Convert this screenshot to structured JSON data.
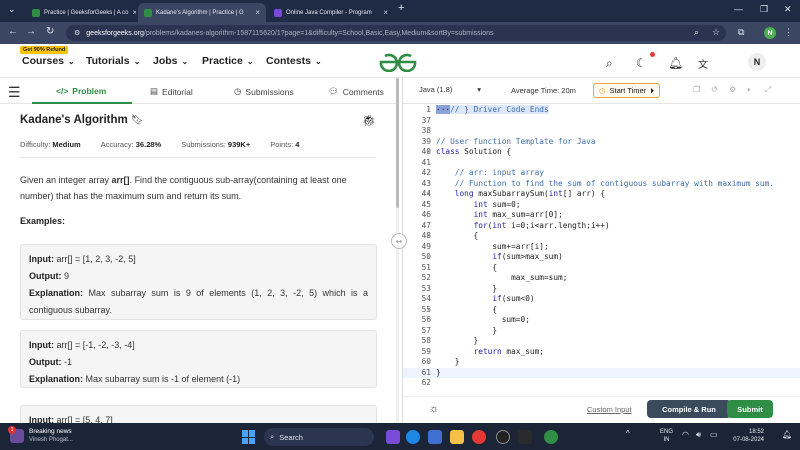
{
  "browser": {
    "tabs": [
      {
        "title": "Practice | GeeksforGeeks | A co",
        "color": "#2f8d46",
        "active": false
      },
      {
        "title": "Kadane's Algorithm | Practice | G",
        "color": "#2f8d46",
        "active": true
      },
      {
        "title": "Online Java Compiler - Program",
        "color": "#7a4bd6",
        "active": false
      }
    ],
    "new_tab": "+",
    "url_host": "geeksforgeeks.org",
    "url_path": "/problems/kadanes-algorithm-1587115620/1?page=1&difficulty=School,Basic,Easy,Medium&sortBy=submissions",
    "profile_initial": "N"
  },
  "site": {
    "refund_badge": "Get 90% Refund",
    "menus": [
      "Courses",
      "Tutorials",
      "Jobs",
      "Practice",
      "Contests"
    ],
    "avatar": "N",
    "brand_color": "#2f8d46"
  },
  "problem": {
    "tabs": [
      "Problem",
      "Editorial",
      "Submissions",
      "Comments"
    ],
    "title": "Kadane's Algorithm",
    "difficulty_label": "Difficulty:",
    "difficulty": "Medium",
    "accuracy_label": "Accuracy:",
    "accuracy": "36.28%",
    "submissions_label": "Submissions:",
    "submissions": "939K+",
    "points_label": "Points:",
    "points": "4",
    "description_pre": "Given an integer array ",
    "description_arr": "arr[]",
    "description_post": ". Find the contiguous sub-array(containing at least one number) that has the maximum sum and return its sum.",
    "examples_heading": "Examples:",
    "examples": [
      {
        "input": "arr[] = [1, 2, 3, -2, 5]",
        "output": "9",
        "explanation": "Max subarray sum is 9 of elements (1, 2, 3, -2, 5) which is a contiguous subarray."
      },
      {
        "input": "arr[] = [-1, -2, -3, -4]",
        "output": "-1",
        "explanation": "Max subarray sum is -1 of element (-1)"
      },
      {
        "input": "arr[] = [5, 4, 7]",
        "output": "",
        "explanation": ""
      }
    ],
    "input_label": "Input:",
    "output_label": "Output:",
    "explanation_label": "Explanation:"
  },
  "editor": {
    "language": "Java (1.8)",
    "avg_time": "Average Time: 20m",
    "timer_label": "Start Timer",
    "lines": [
      {
        "n": "1",
        "text": "// } Driver Code Ends",
        "fold": true
      },
      {
        "n": "37",
        "text": ""
      },
      {
        "n": "38",
        "text": ""
      },
      {
        "n": "39",
        "text": "// User function Template for Java"
      },
      {
        "n": "40",
        "text": "class Solution {",
        "fold": true
      },
      {
        "n": "41",
        "text": ""
      },
      {
        "n": "42",
        "text": "    // arr: input array"
      },
      {
        "n": "43",
        "text": "    // Function to find the sum of contiguous subarray with maximum sum."
      },
      {
        "n": "44",
        "text": "    long maxSubarraySum(int[] arr) {",
        "fold": true
      },
      {
        "n": "45",
        "text": "        int sum=0;"
      },
      {
        "n": "46",
        "text": "        int max_sum=arr[0];"
      },
      {
        "n": "47",
        "text": "        for(int i=0;i<arr.length;i++)"
      },
      {
        "n": "48",
        "text": "        {",
        "fold": true
      },
      {
        "n": "49",
        "text": "            sum+=arr[i];"
      },
      {
        "n": "50",
        "text": "            if(sum>max_sum)"
      },
      {
        "n": "51",
        "text": "            {",
        "fold": true
      },
      {
        "n": "52",
        "text": "                max_sum=sum;"
      },
      {
        "n": "53",
        "text": "            }"
      },
      {
        "n": "54",
        "text": "            if(sum<0)"
      },
      {
        "n": "55",
        "text": "            {",
        "fold": true
      },
      {
        "n": "56",
        "text": "              sum=0;"
      },
      {
        "n": "57",
        "text": "            }"
      },
      {
        "n": "58",
        "text": "        }"
      },
      {
        "n": "59",
        "text": "        return max_sum;"
      },
      {
        "n": "60",
        "text": "    }"
      },
      {
        "n": "61",
        "text": "}"
      },
      {
        "n": "62",
        "text": ""
      }
    ],
    "custom_input": "Custom Input",
    "compile_run": "Compile & Run",
    "submit": "Submit"
  },
  "taskbar": {
    "news_title": "Breaking news",
    "news_sub": "Vinesh Phogat...",
    "news_badge": "1",
    "search_placeholder": "Search",
    "lang_top": "ENG",
    "lang_bottom": "IN",
    "time": "18:52",
    "date": "07-08-2024"
  }
}
